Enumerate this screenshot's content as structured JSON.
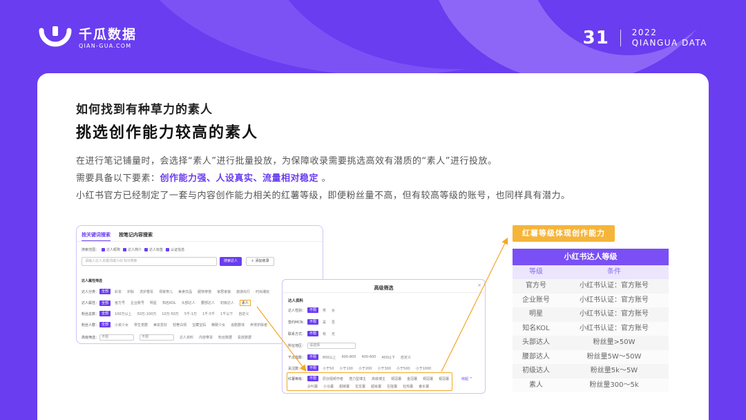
{
  "brand": {
    "name_cn": "千瓜数据",
    "name_en": "QIAN-GUA.COM"
  },
  "page": {
    "number": "31",
    "year": "2022",
    "series": "QIANGUA DATA"
  },
  "colors": {
    "primary": "#6a3df0",
    "accent": "#f5b53a"
  },
  "content": {
    "subtitle": "如何找到有种草力的素人",
    "title": "挑选创作能力较高的素人",
    "para1": "在进行笔记铺量时，会选择“素人”进行批量投放，为保障收录需要挑选高效有潜质的“素人”进行投放。",
    "para2_prefix": "需要具备以下要素：",
    "para2_highlight": "创作能力强、人设真实、流量相对稳定",
    "para2_suffix": " 。",
    "para3": "小红书官方已经制定了一套与内容创作能力相关的红薯等级，即便粉丝量不高，但有较高等级的账号，也同样具有潜力。"
  },
  "search_panel": {
    "tabs": [
      "按关键词搜索",
      "按笔记内容搜索"
    ],
    "scope_label": "搜索范围：",
    "scope_options": [
      "达人昵称",
      "达人简介",
      "达人标签",
      "认证信息"
    ],
    "search_placeholder": "请输入达人关键词或小红书ID搜索",
    "search_button": "搜索达人",
    "add_button": "＋ 添加收录",
    "section": "达人属性筛选",
    "category_label": "达人分类：",
    "category_all": "全部",
    "category_options": [
      "彩妆",
      "护肤",
      "洗护香氛",
      "母婴育儿",
      "美食饮品",
      "服饰穿搭",
      "家居家装",
      "旅游出行",
      "时尚潮玩"
    ],
    "attr_label": "达人属性：",
    "attr_all": "全部",
    "attr_options": [
      "官方号",
      "企业账号",
      "明星",
      "知名KOL",
      "头部达人",
      "腰部达人",
      "初级达人",
      "素人"
    ],
    "fans_label": "粉丝总数：",
    "fans_all": "全部",
    "fans_options": [
      "100万以上",
      "50万-100万",
      "10万-50万",
      "5千-1万",
      "1千-5千",
      "1千以下",
      "自定义"
    ],
    "audience_label": "粉丝人群：",
    "audience_all": "全部",
    "audience_options": [
      "小资少女",
      "學生党群",
      "美妆爱好",
      "轻奢白领",
      "宝藏宝妈",
      "精致少女",
      "追剧群体",
      "养宠护肤者"
    ],
    "more_label": "高级筛选：",
    "select1": "不限",
    "select2": "不限",
    "extra_links": [
      "达人资料",
      "内容带货",
      "粉丝数据",
      "投放数据"
    ]
  },
  "advanced_panel": {
    "title": "高级筛选",
    "close": "×",
    "section": "达人资料",
    "gender_label": "达人性别：",
    "gender_options": [
      "不限",
      "男",
      "女"
    ],
    "mcn_label": "签约MCN：",
    "mcn_options": [
      "不限",
      "是",
      "否"
    ],
    "contact_label": "联系方式：",
    "contact_options": [
      "不限",
      "有",
      "无"
    ],
    "region_label": "所在地区：",
    "region_placeholder": "请选择",
    "age_label": "千瓜指数：",
    "age_options": [
      "不限",
      "800以上",
      "600-800",
      "400-600",
      "400以下",
      "自定义"
    ],
    "follow_label": "关注数：",
    "follow_options": [
      "不限",
      "小于50",
      "小于100",
      "小于200",
      "小于300",
      "小于500",
      "小于1000"
    ],
    "level_label": "红薯等级：",
    "level_options_row1": [
      "不限",
      "原创视频作者",
      "潜力型博主",
      "高级博主",
      "铜冠薯",
      "金冠薯",
      "铜冠薯",
      "银冠薯"
    ],
    "level_options_row2": [
      "尖叫薯",
      "小马薯",
      "甜椒薯",
      "龙龙薯",
      "超级薯",
      "巨能薯",
      "狂热薯",
      "番长薯"
    ],
    "more": "收起 ^"
  },
  "level_table": {
    "badge": "红薯等级体现创作能力",
    "caption": "小红书达人等级",
    "headers": [
      "等级",
      "条件"
    ],
    "rows": [
      [
        "官方号",
        "小红书认证：官方账号"
      ],
      [
        "企业账号",
        "小红书认证：官方账号"
      ],
      [
        "明星",
        "小红书认证：官方账号"
      ],
      [
        "知名KOL",
        "小红书认证：官方账号"
      ],
      [
        "头部达人",
        "粉丝量>50W"
      ],
      [
        "腰部达人",
        "粉丝量5W～50W"
      ],
      [
        "初级达人",
        "粉丝量5k～5W"
      ],
      [
        "素人",
        "粉丝量300～5k"
      ]
    ]
  }
}
